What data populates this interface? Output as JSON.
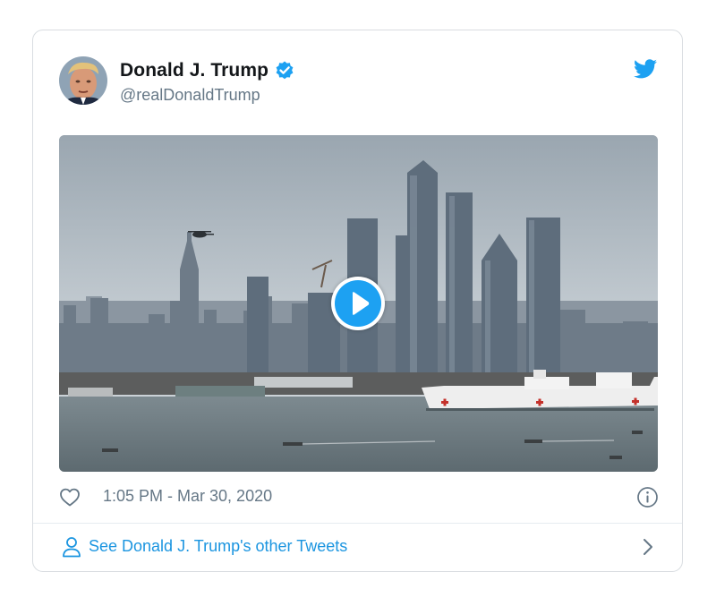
{
  "tweet": {
    "author": {
      "name": "Donald J. Trump",
      "handle": "@realDonaldTrump",
      "verified": true
    },
    "media": {
      "type": "video",
      "icon": "play-icon"
    },
    "timestamp": "1:05 PM - Mar 30, 2020",
    "footer_link": "See Donald J. Trump's other Tweets"
  },
  "icons": {
    "brand": "twitter-bird-icon",
    "verified": "verified-badge-icon",
    "like": "heart-icon",
    "info": "info-icon",
    "profile": "person-icon",
    "next": "chevron-right-icon"
  },
  "colors": {
    "brand_blue": "#1da1f2",
    "link_blue": "#1b95e0",
    "secondary_text": "#657786",
    "border": "#d9dde1"
  }
}
